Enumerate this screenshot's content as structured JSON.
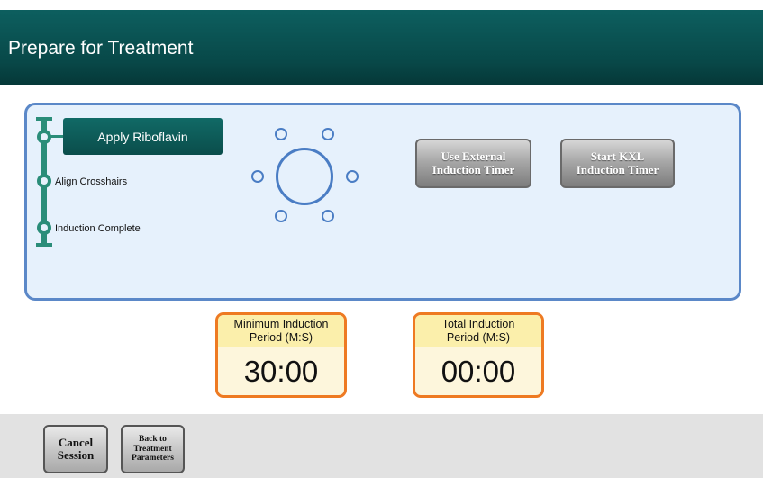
{
  "header": {
    "title": "Prepare for Treatment"
  },
  "steps": {
    "active_label": "Apply Riboflavin",
    "items": [
      {
        "label": "Align Crosshairs"
      },
      {
        "label": "Induction Complete"
      }
    ]
  },
  "buttons": {
    "external_timer_line1": "Use External",
    "external_timer_line2": "Induction Timer",
    "start_kxl_line1": "Start KXL",
    "start_kxl_line2": "Induction Timer"
  },
  "timers": {
    "minimum": {
      "label_line1": "Minimum Induction",
      "label_line2": "Period (M:S)",
      "value": "30:00"
    },
    "total": {
      "label_line1": "Total Induction",
      "label_line2": "Period (M:S)",
      "value": "00:00"
    }
  },
  "footer": {
    "cancel_line1": "Cancel",
    "cancel_line2": "Session",
    "back_line1": "Back to",
    "back_line2": "Treatment",
    "back_line3": "Parameters"
  },
  "colors": {
    "header": "#084848",
    "step_active": "#0d5c59",
    "rail": "#2a8d79",
    "panel_bg": "#e6f1fc",
    "panel_border": "#5b88c8",
    "timer_border": "#ee7a22"
  },
  "icons": {
    "step_marker": "circle-node-icon",
    "eye_target": "eye-target-icon"
  }
}
